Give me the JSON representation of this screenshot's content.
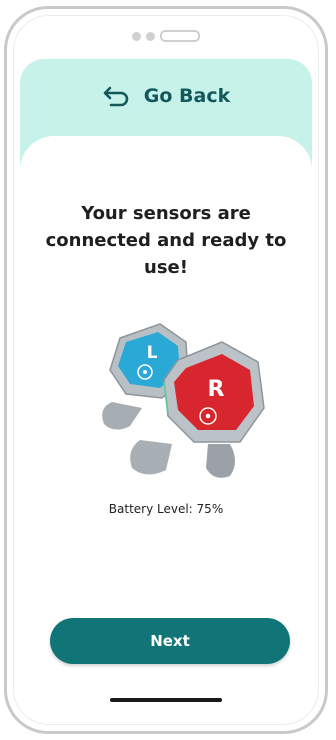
{
  "colors": {
    "header_bg": "#c6f2ea",
    "accent": "#117476",
    "sensor_left": "#2aa9d6",
    "sensor_right": "#d8262e"
  },
  "header": {
    "back_label": "Go Back",
    "back_icon": "return-arrow-icon"
  },
  "main": {
    "title": "Your sensors are connected and ready to use!",
    "sensors": {
      "left_letter": "L",
      "right_letter": "R"
    },
    "battery_text": "Battery Level: 75%"
  },
  "footer": {
    "next_label": "Next"
  }
}
